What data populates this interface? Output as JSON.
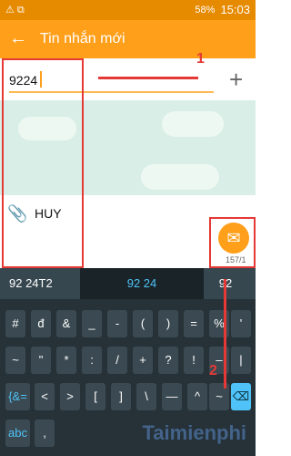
{
  "status_bar": {
    "left": "⚠  ⧉",
    "battery": "58%",
    "time": "15:03"
  },
  "app_bar": {
    "back_icon": "←",
    "title": "Tin nhắn mới"
  },
  "recipient": {
    "value": "9224",
    "plus_icon": "+"
  },
  "compose": {
    "attach_icon": "📎",
    "text": "HUY",
    "send_icon": "✉",
    "count": "157/1"
  },
  "keyboard": {
    "suggestions": [
      "92 24T2",
      "92 24",
      "92"
    ],
    "rows": [
      [
        "#",
        "đ",
        "&",
        "_",
        "-",
        "(",
        ")",
        "=",
        "%",
        "'"
      ],
      [
        "~",
        "\"",
        "*",
        ":",
        "/",
        "+",
        "?",
        "!",
        "–",
        "|"
      ],
      [
        "{&=",
        "<",
        ">",
        "[",
        "]",
        "\\",
        "—",
        "^",
        "~",
        "⌫"
      ],
      [
        "abc",
        ",",
        "",
        "",
        "",
        "",
        "",
        "",
        "",
        ""
      ]
    ]
  },
  "annotations": {
    "num1": "1",
    "num2": "2",
    "watermark": "Taimienphi"
  }
}
